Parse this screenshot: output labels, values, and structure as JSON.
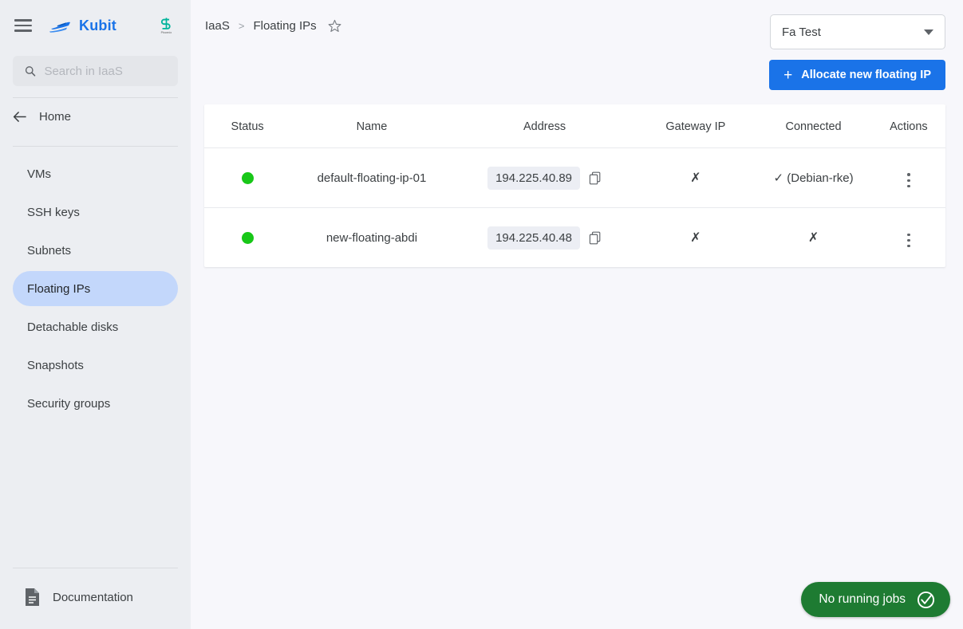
{
  "sidebar": {
    "brand": {
      "name": "Kubit",
      "logo_icon": "speedboat-icon",
      "partner_logo_icon": "partner-s-icon",
      "partner_sub": "Phoenix"
    },
    "menu_icon": "hamburger-icon",
    "search": {
      "placeholder": "Search in IaaS",
      "value": "",
      "icon": "search-icon"
    },
    "home": {
      "label": "Home",
      "icon": "arrow-left-icon"
    },
    "items": [
      {
        "label": "VMs",
        "active": false
      },
      {
        "label": "SSH keys",
        "active": false
      },
      {
        "label": "Subnets",
        "active": false
      },
      {
        "label": "Floating IPs",
        "active": true
      },
      {
        "label": "Detachable disks",
        "active": false
      },
      {
        "label": "Snapshots",
        "active": false
      },
      {
        "label": "Security groups",
        "active": false
      }
    ],
    "footer": {
      "label": "Documentation",
      "icon": "document-icon"
    }
  },
  "header": {
    "breadcrumb": {
      "root": "IaaS",
      "separator": ">",
      "current": "Floating IPs",
      "favorite_icon": "star-outline-icon"
    },
    "project_select": {
      "value": "Fa Test",
      "icon": "chevron-down-icon"
    },
    "allocate_button": {
      "label": "Allocate new floating IP",
      "icon": "plus-icon"
    }
  },
  "table": {
    "columns": [
      "Status",
      "Name",
      "Address",
      "Gateway IP",
      "Connected",
      "Actions"
    ],
    "rows": [
      {
        "status": "active",
        "status_color": "#18c718",
        "name": "default-floating-ip-01",
        "address": "194.225.40.89",
        "copy_icon": "copy-icon",
        "gateway_ip": "✗",
        "connected": "✓ (Debian-rke)",
        "actions_icon": "kebab-menu-icon"
      },
      {
        "status": "active",
        "status_color": "#18c718",
        "name": "new-floating-abdi",
        "address": "194.225.40.48",
        "copy_icon": "copy-icon",
        "gateway_ip": "✗",
        "connected": "✗",
        "actions_icon": "kebab-menu-icon"
      }
    ]
  },
  "annotation": {
    "arrow_icon": "red-arrow-pointing-down-left",
    "color": "#e11b22"
  },
  "status_pill": {
    "label": "No running jobs",
    "icon": "check-circle-icon",
    "color": "#1e7b32"
  },
  "colors": {
    "accent": "#1a73e8",
    "sidebar_bg": "#eceef2",
    "active_item_bg": "#c3d7fb",
    "page_bg": "#f7f7fb"
  }
}
